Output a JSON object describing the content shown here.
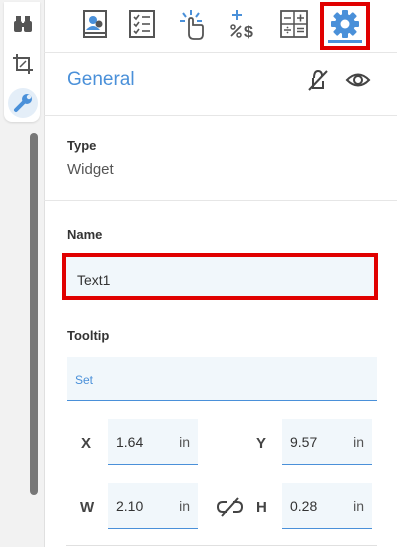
{
  "rail": {
    "tools": [
      {
        "icon": "binoculars-icon"
      },
      {
        "icon": "crop-frame-icon"
      },
      {
        "icon": "wrench-icon",
        "active": true
      }
    ]
  },
  "tabs": [
    {
      "icon": "document-user-icon"
    },
    {
      "icon": "checklist-icon"
    },
    {
      "icon": "tap-action-icon"
    },
    {
      "icon": "calculate-icon"
    },
    {
      "icon": "format-grid-icon"
    },
    {
      "icon": "gear-icon",
      "active": true
    }
  ],
  "general": {
    "title": "General"
  },
  "type": {
    "label": "Type",
    "value": "Widget"
  },
  "name": {
    "label": "Name",
    "value": "Text1"
  },
  "tooltip": {
    "label": "Tooltip",
    "placeholder": "Set"
  },
  "position": {
    "x": {
      "label": "X",
      "value": "1.64",
      "unit": "in"
    },
    "y": {
      "label": "Y",
      "value": "9.57",
      "unit": "in"
    },
    "w": {
      "label": "W",
      "value": "2.10",
      "unit": "in"
    },
    "h": {
      "label": "H",
      "value": "0.28",
      "unit": "in"
    }
  },
  "colors": {
    "accent": "#4a90d9",
    "highlight": "#e00000",
    "field_bg": "#f1f7fb"
  }
}
